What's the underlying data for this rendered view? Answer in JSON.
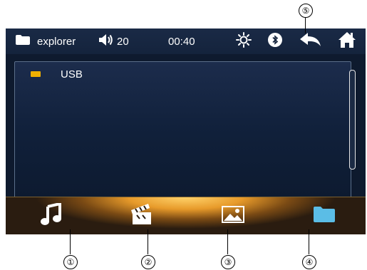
{
  "statusbar": {
    "title": "explorer",
    "volume": "20",
    "time": "00:40"
  },
  "list": {
    "items": [
      {
        "label": "USB",
        "icon": "usb-drive-icon"
      }
    ]
  },
  "bottombar": {
    "buttons": [
      {
        "name": "music",
        "icon": "music-note-icon"
      },
      {
        "name": "video",
        "icon": "clapperboard-icon"
      },
      {
        "name": "photo",
        "icon": "picture-icon"
      },
      {
        "name": "folder",
        "icon": "folder-icon",
        "color": "#5bbde6"
      }
    ]
  },
  "callouts": [
    "①",
    "②",
    "③",
    "④",
    "⑤"
  ],
  "colors": {
    "accent": "#f0b000",
    "folder": "#5bbde6",
    "bar": "#e79a2a"
  }
}
